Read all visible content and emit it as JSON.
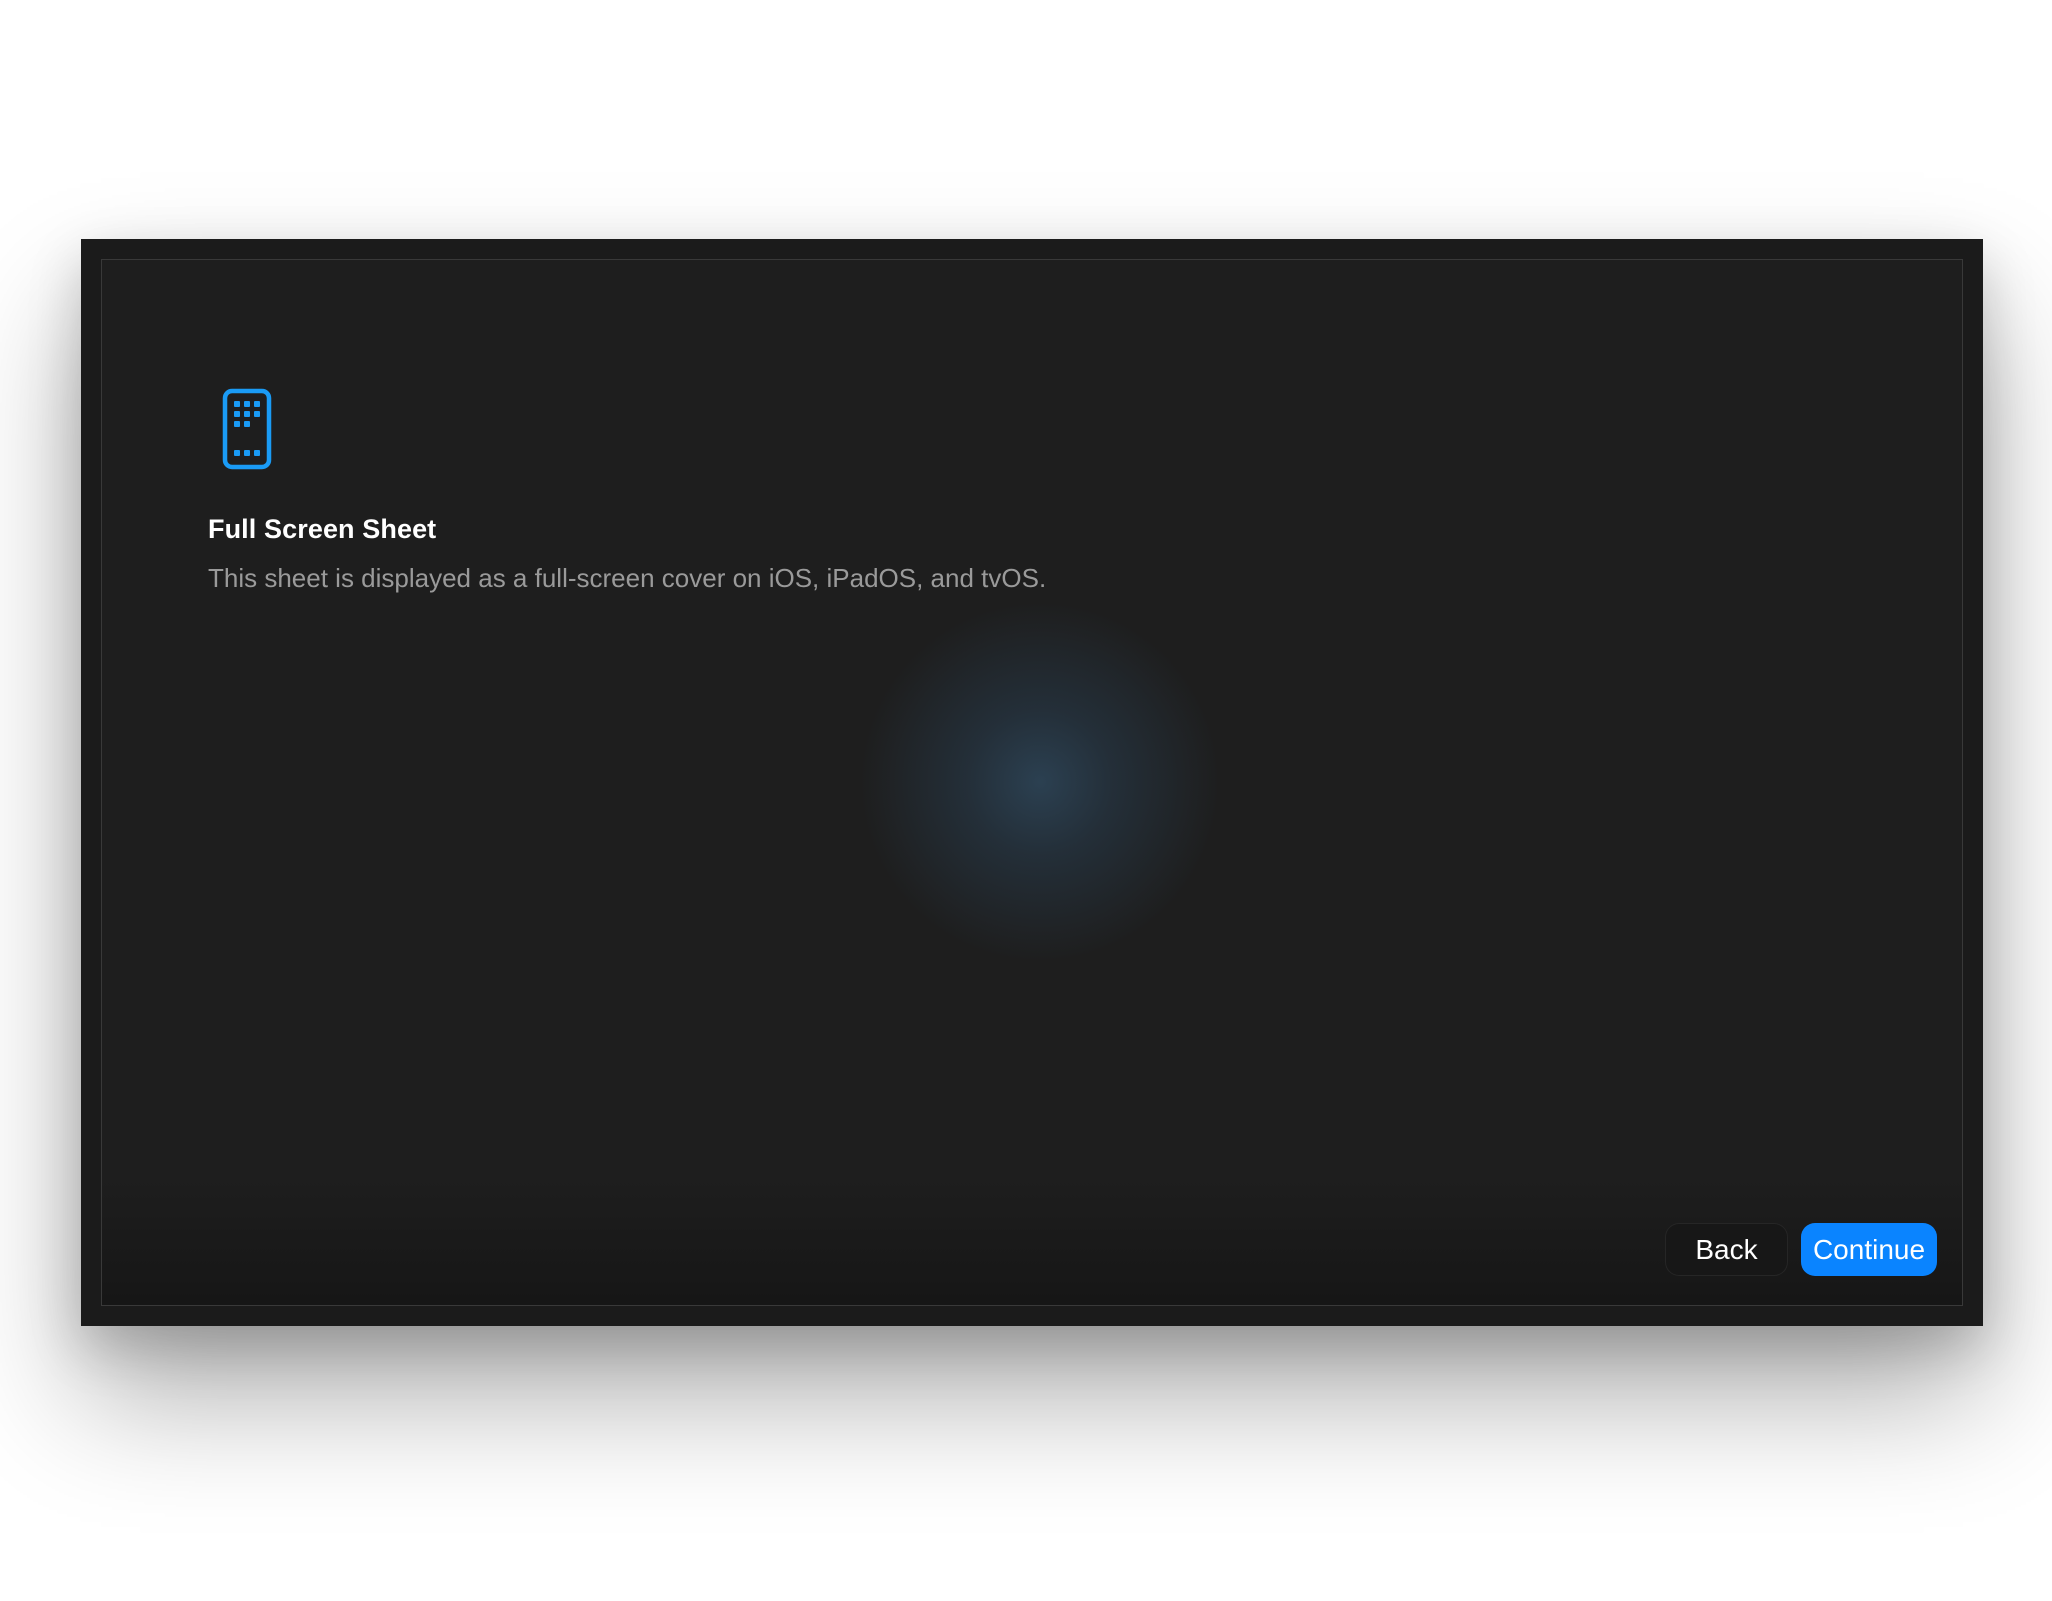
{
  "sheet": {
    "icon": "iphone-homescreen-icon",
    "title": "Full Screen Sheet",
    "description": "This sheet is displayed as a full-screen cover on iOS, iPadOS, and tvOS."
  },
  "buttons": {
    "back_label": "Back",
    "continue_label": "Continue"
  },
  "colors": {
    "accent": "#0a84ff",
    "background": "#1e1e1e",
    "title": "#ffffff",
    "subtitle": "#9a9a9a"
  }
}
